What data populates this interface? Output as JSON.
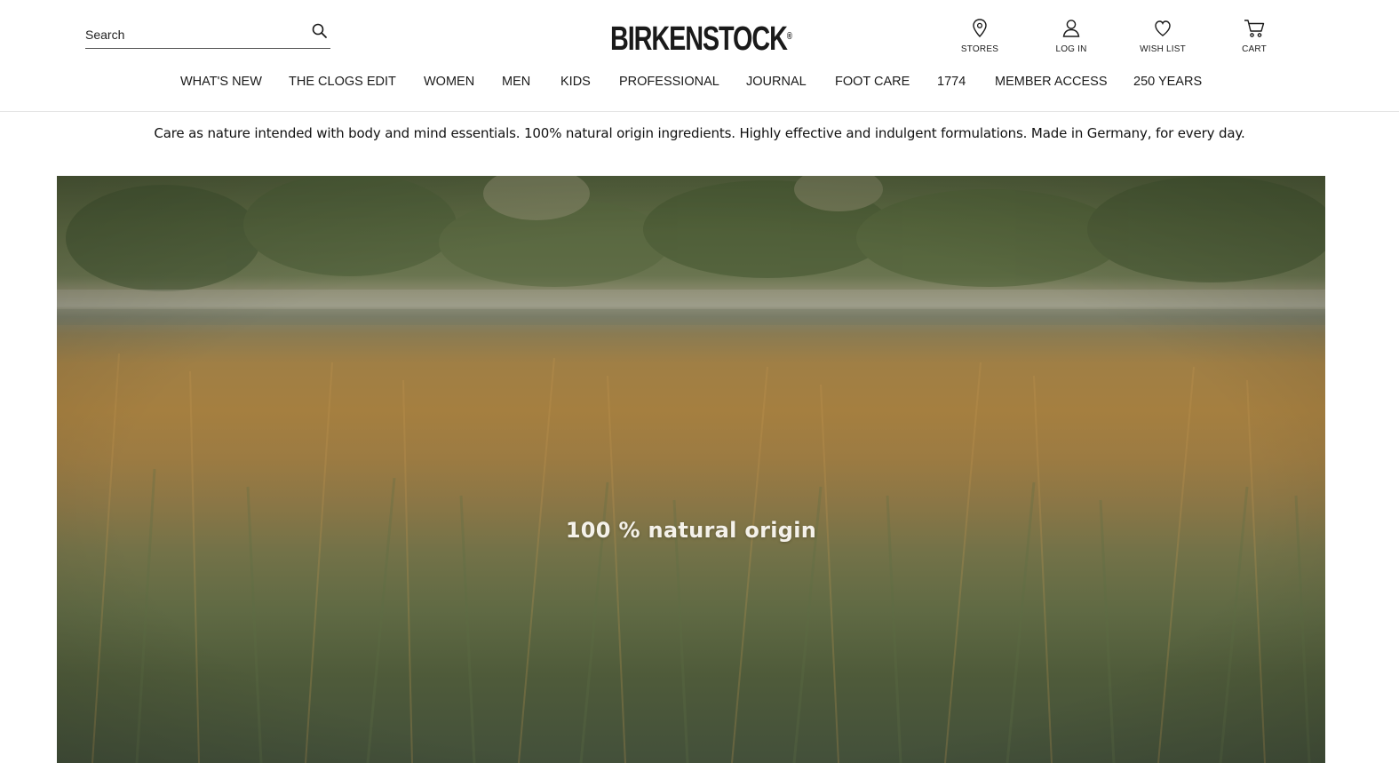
{
  "header": {
    "search": {
      "placeholder": "Search",
      "value": ""
    },
    "logo": {
      "text": "BIRKENSTOCK",
      "mark": "®"
    },
    "utilities": [
      {
        "label": "STORES",
        "icon": "location-pin-icon"
      },
      {
        "label": "LOG IN",
        "icon": "user-icon"
      },
      {
        "label": "WISH LIST",
        "icon": "heart-icon"
      },
      {
        "label": "CART",
        "icon": "cart-icon"
      }
    ]
  },
  "nav": {
    "items": [
      "WHAT'S NEW",
      "THE CLOGS EDIT",
      "WOMEN",
      "MEN",
      "KIDS",
      "PROFESSIONAL",
      "JOURNAL",
      "FOOT CARE",
      "1774",
      "MEMBER ACCESS",
      "250 YEARS"
    ]
  },
  "tagline": "Care as nature intended with body and mind essentials. 100% natural origin ingredients. Highly effective and indulgent formulations. Made in Germany, for every day.",
  "hero": {
    "title": "100 % natural origin",
    "image_subject": "grassy-reeds-by-lake"
  },
  "colors": {
    "text": "#1a1a1a",
    "border": "#e4e4e4",
    "hero_text": "#f4f1ea"
  }
}
